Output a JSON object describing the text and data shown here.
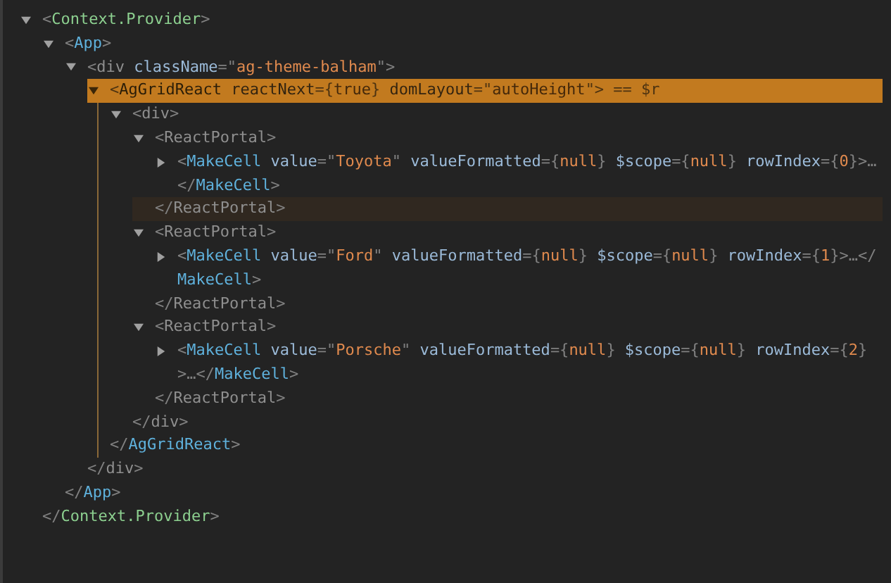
{
  "tree": [
    {
      "open": [
        {
          "text": "<",
          "kind": "punct"
        },
        {
          "text": "Context.Provider",
          "kind": "context"
        },
        {
          "text": ">",
          "kind": "punct"
        }
      ],
      "close": [
        {
          "text": "</",
          "kind": "punct"
        },
        {
          "text": "Context.Provider",
          "kind": "context"
        },
        {
          "text": ">",
          "kind": "punct"
        }
      ],
      "expanded": true,
      "selected": false,
      "close_hovered": false,
      "children": [
        {
          "open": [
            {
              "text": "<",
              "kind": "punct"
            },
            {
              "text": "App",
              "kind": "component"
            },
            {
              "text": ">",
              "kind": "punct"
            }
          ],
          "close": [
            {
              "text": "</",
              "kind": "punct"
            },
            {
              "text": "App",
              "kind": "component"
            },
            {
              "text": ">",
              "kind": "punct"
            }
          ],
          "expanded": true,
          "selected": false,
          "close_hovered": false,
          "children": [
            {
              "open": [
                {
                  "text": "<",
                  "kind": "punct"
                },
                {
                  "text": "div",
                  "kind": "host"
                },
                {
                  "text": " className",
                  "kind": "attribute"
                },
                {
                  "text": "=\"",
                  "kind": "punct"
                },
                {
                  "text": "ag-theme-balham",
                  "kind": "value"
                },
                {
                  "text": "\">",
                  "kind": "punct"
                }
              ],
              "close": [
                {
                  "text": "</",
                  "kind": "punct"
                },
                {
                  "text": "div",
                  "kind": "host"
                },
                {
                  "text": ">",
                  "kind": "punct"
                }
              ],
              "expanded": true,
              "selected": false,
              "close_hovered": false,
              "children": [
                {
                  "open": [
                    {
                      "text": "<",
                      "kind": "punct"
                    },
                    {
                      "text": "AgGridReact",
                      "kind": "component"
                    },
                    {
                      "text": " reactNext",
                      "kind": "attribute"
                    },
                    {
                      "text": "={",
                      "kind": "punct"
                    },
                    {
                      "text": "true",
                      "kind": "value"
                    },
                    {
                      "text": "}",
                      "kind": "punct"
                    },
                    {
                      "text": " domLayout",
                      "kind": "attribute"
                    },
                    {
                      "text": "=\"",
                      "kind": "punct"
                    },
                    {
                      "text": "autoHeight",
                      "kind": "value"
                    },
                    {
                      "text": "\">",
                      "kind": "punct"
                    },
                    {
                      "text": " == $r",
                      "kind": "punct"
                    }
                  ],
                  "close": [
                    {
                      "text": "</",
                      "kind": "punct"
                    },
                    {
                      "text": "AgGridReact",
                      "kind": "component"
                    },
                    {
                      "text": ">",
                      "kind": "punct"
                    }
                  ],
                  "expanded": true,
                  "selected": true,
                  "close_hovered": false,
                  "children": [
                    {
                      "open": [
                        {
                          "text": "<",
                          "kind": "punct"
                        },
                        {
                          "text": "div",
                          "kind": "host"
                        },
                        {
                          "text": ">",
                          "kind": "punct"
                        }
                      ],
                      "close": [
                        {
                          "text": "</",
                          "kind": "punct"
                        },
                        {
                          "text": "div",
                          "kind": "host"
                        },
                        {
                          "text": ">",
                          "kind": "punct"
                        }
                      ],
                      "expanded": true,
                      "selected": false,
                      "close_hovered": false,
                      "children": [
                        {
                          "open": [
                            {
                              "text": "<",
                              "kind": "punct"
                            },
                            {
                              "text": "ReactPortal",
                              "kind": "host"
                            },
                            {
                              "text": ">",
                              "kind": "punct"
                            }
                          ],
                          "close": [
                            {
                              "text": "</",
                              "kind": "punct"
                            },
                            {
                              "text": "ReactPortal",
                              "kind": "host"
                            },
                            {
                              "text": ">",
                              "kind": "punct"
                            }
                          ],
                          "expanded": true,
                          "selected": false,
                          "close_hovered": true,
                          "children": [
                            {
                              "open": [
                                {
                                  "text": "<",
                                  "kind": "punct"
                                },
                                {
                                  "text": "MakeCell",
                                  "kind": "component"
                                },
                                {
                                  "text": " value",
                                  "kind": "attribute"
                                },
                                {
                                  "text": "=\"",
                                  "kind": "punct"
                                },
                                {
                                  "text": "Toyota",
                                  "kind": "value"
                                },
                                {
                                  "text": "\"",
                                  "kind": "punct"
                                },
                                {
                                  "text": " valueFormatted",
                                  "kind": "attribute"
                                },
                                {
                                  "text": "={",
                                  "kind": "punct"
                                },
                                {
                                  "text": "null",
                                  "kind": "value"
                                },
                                {
                                  "text": "}",
                                  "kind": "punct"
                                },
                                {
                                  "text": " $scope",
                                  "kind": "attribute"
                                },
                                {
                                  "text": "={",
                                  "kind": "punct"
                                },
                                {
                                  "text": "null",
                                  "kind": "value"
                                },
                                {
                                  "text": "}",
                                  "kind": "punct"
                                },
                                {
                                  "text": " rowIndex",
                                  "kind": "attribute"
                                },
                                {
                                  "text": "={",
                                  "kind": "punct"
                                },
                                {
                                  "text": "0",
                                  "kind": "value"
                                },
                                {
                                  "text": "}>…</",
                                  "kind": "punct"
                                },
                                {
                                  "text": "MakeCell",
                                  "kind": "component"
                                },
                                {
                                  "text": ">",
                                  "kind": "punct"
                                }
                              ],
                              "expanded": false,
                              "selected": false
                            }
                          ]
                        },
                        {
                          "open": [
                            {
                              "text": "<",
                              "kind": "punct"
                            },
                            {
                              "text": "ReactPortal",
                              "kind": "host"
                            },
                            {
                              "text": ">",
                              "kind": "punct"
                            }
                          ],
                          "close": [
                            {
                              "text": "</",
                              "kind": "punct"
                            },
                            {
                              "text": "ReactPortal",
                              "kind": "host"
                            },
                            {
                              "text": ">",
                              "kind": "punct"
                            }
                          ],
                          "expanded": true,
                          "selected": false,
                          "close_hovered": false,
                          "children": [
                            {
                              "open": [
                                {
                                  "text": "<",
                                  "kind": "punct"
                                },
                                {
                                  "text": "MakeCell",
                                  "kind": "component"
                                },
                                {
                                  "text": " value",
                                  "kind": "attribute"
                                },
                                {
                                  "text": "=\"",
                                  "kind": "punct"
                                },
                                {
                                  "text": "Ford",
                                  "kind": "value"
                                },
                                {
                                  "text": "\"",
                                  "kind": "punct"
                                },
                                {
                                  "text": " valueFormatted",
                                  "kind": "attribute"
                                },
                                {
                                  "text": "={",
                                  "kind": "punct"
                                },
                                {
                                  "text": "null",
                                  "kind": "value"
                                },
                                {
                                  "text": "}",
                                  "kind": "punct"
                                },
                                {
                                  "text": " $scope",
                                  "kind": "attribute"
                                },
                                {
                                  "text": "={",
                                  "kind": "punct"
                                },
                                {
                                  "text": "null",
                                  "kind": "value"
                                },
                                {
                                  "text": "}",
                                  "kind": "punct"
                                },
                                {
                                  "text": " rowIndex",
                                  "kind": "attribute"
                                },
                                {
                                  "text": "={",
                                  "kind": "punct"
                                },
                                {
                                  "text": "1",
                                  "kind": "value"
                                },
                                {
                                  "text": "}>…</",
                                  "kind": "punct"
                                },
                                {
                                  "text": "MakeCell",
                                  "kind": "component"
                                },
                                {
                                  "text": ">",
                                  "kind": "punct"
                                }
                              ],
                              "expanded": false,
                              "selected": false
                            }
                          ]
                        },
                        {
                          "open": [
                            {
                              "text": "<",
                              "kind": "punct"
                            },
                            {
                              "text": "ReactPortal",
                              "kind": "host"
                            },
                            {
                              "text": ">",
                              "kind": "punct"
                            }
                          ],
                          "close": [
                            {
                              "text": "</",
                              "kind": "punct"
                            },
                            {
                              "text": "ReactPortal",
                              "kind": "host"
                            },
                            {
                              "text": ">",
                              "kind": "punct"
                            }
                          ],
                          "expanded": true,
                          "selected": false,
                          "close_hovered": false,
                          "children": [
                            {
                              "open": [
                                {
                                  "text": "<",
                                  "kind": "punct"
                                },
                                {
                                  "text": "MakeCell",
                                  "kind": "component"
                                },
                                {
                                  "text": " value",
                                  "kind": "attribute"
                                },
                                {
                                  "text": "=\"",
                                  "kind": "punct"
                                },
                                {
                                  "text": "Porsche",
                                  "kind": "value"
                                },
                                {
                                  "text": "\"",
                                  "kind": "punct"
                                },
                                {
                                  "text": " valueFormatted",
                                  "kind": "attribute"
                                },
                                {
                                  "text": "={",
                                  "kind": "punct"
                                },
                                {
                                  "text": "null",
                                  "kind": "value"
                                },
                                {
                                  "text": "}",
                                  "kind": "punct"
                                },
                                {
                                  "text": " $scope",
                                  "kind": "attribute"
                                },
                                {
                                  "text": "={",
                                  "kind": "punct"
                                },
                                {
                                  "text": "null",
                                  "kind": "value"
                                },
                                {
                                  "text": "}",
                                  "kind": "punct"
                                },
                                {
                                  "text": " rowIndex",
                                  "kind": "attribute"
                                },
                                {
                                  "text": "={",
                                  "kind": "punct"
                                },
                                {
                                  "text": "2",
                                  "kind": "value"
                                },
                                {
                                  "text": "}>…</",
                                  "kind": "punct"
                                },
                                {
                                  "text": "MakeCell",
                                  "kind": "component"
                                },
                                {
                                  "text": ">",
                                  "kind": "punct"
                                }
                              ],
                              "expanded": false,
                              "selected": false
                            }
                          ]
                        }
                      ]
                    }
                  ]
                }
              ]
            }
          ]
        }
      ]
    }
  ]
}
